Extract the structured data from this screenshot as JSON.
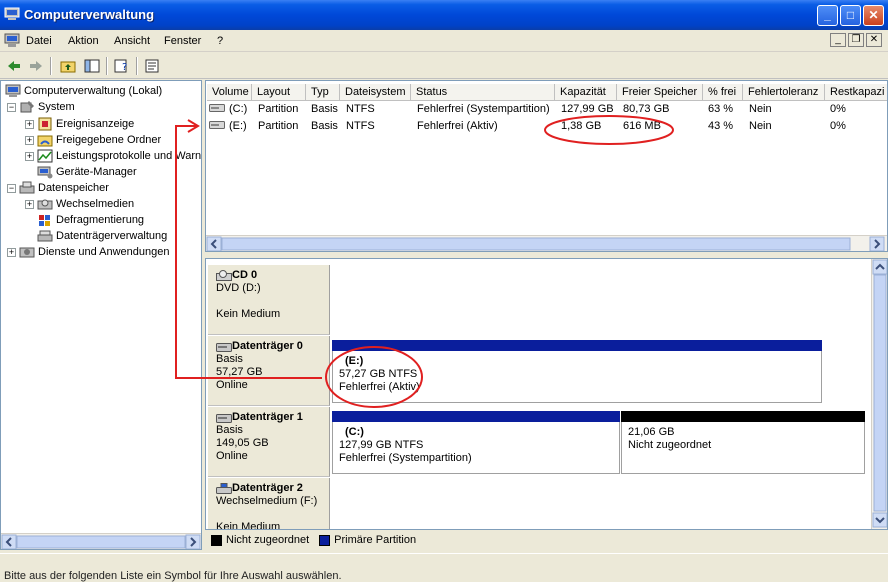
{
  "window": {
    "title": "Computerverwaltung",
    "min": "_",
    "max": "□",
    "close": "✕"
  },
  "menu": {
    "items": [
      "Datei",
      "Aktion",
      "Ansicht",
      "Fenster",
      "?"
    ]
  },
  "tree": {
    "root": "Computerverwaltung (Lokal)",
    "system": "System",
    "system_items": [
      "Ereignisanzeige",
      "Freigegebene Ordner",
      "Leistungsprotokolle und Warn",
      "Geräte-Manager"
    ],
    "storage": "Datenspeicher",
    "storage_items": [
      "Wechselmedien",
      "Defragmentierung",
      "Datenträgerverwaltung"
    ],
    "services": "Dienste und Anwendungen"
  },
  "volumes": {
    "columns": [
      "Volume",
      "Layout",
      "Typ",
      "Dateisystem",
      "Status",
      "Kapazität",
      "Freier Speicher",
      "% frei",
      "Fehlertoleranz",
      "Restkapazi"
    ],
    "rows": [
      [
        "(C:)",
        "Partition",
        "Basis",
        "NTFS",
        "Fehlerfrei (Systempartition)",
        "127,99 GB",
        "80,73 GB",
        "63 %",
        "Nein",
        "0%"
      ],
      [
        "(E:)",
        "Partition",
        "Basis",
        "NTFS",
        "Fehlerfrei (Aktiv)",
        "1,38 GB",
        "616 MB",
        "43 %",
        "Nein",
        "0%"
      ]
    ]
  },
  "disks": [
    {
      "name": "CD 0",
      "lines": [
        "DVD (D:)",
        "",
        "Kein Medium"
      ]
    },
    {
      "name": "Datenträger 0",
      "lines": [
        "Basis",
        "57,27 GB",
        "Online"
      ],
      "partitions": [
        {
          "title": "(E:)",
          "size": "57,27 GB NTFS",
          "status": "Fehlerfrei (Aktiv)"
        }
      ]
    },
    {
      "name": "Datenträger 1",
      "lines": [
        "Basis",
        "149,05 GB",
        "Online"
      ],
      "partitions": [
        {
          "title": "(C:)",
          "size": "127,99 GB NTFS",
          "status": "Fehlerfrei (Systempartition)"
        },
        {
          "title": "",
          "size": "21,06 GB",
          "status": "Nicht zugeordnet"
        }
      ]
    },
    {
      "name": "Datenträger 2",
      "lines": [
        "Wechselmedium (F:)",
        "",
        "Kein Medium"
      ]
    }
  ],
  "legend": {
    "unallocated": "Nicht zugeordnet",
    "primary": "Primäre Partition"
  },
  "status": {
    "text": "Bitte aus der folgenden Liste ein Symbol für Ihre Auswahl auswählen."
  },
  "colors": {
    "primary": "#0a1e9c",
    "unallocated": "#000000",
    "annotation": "#e02020"
  }
}
